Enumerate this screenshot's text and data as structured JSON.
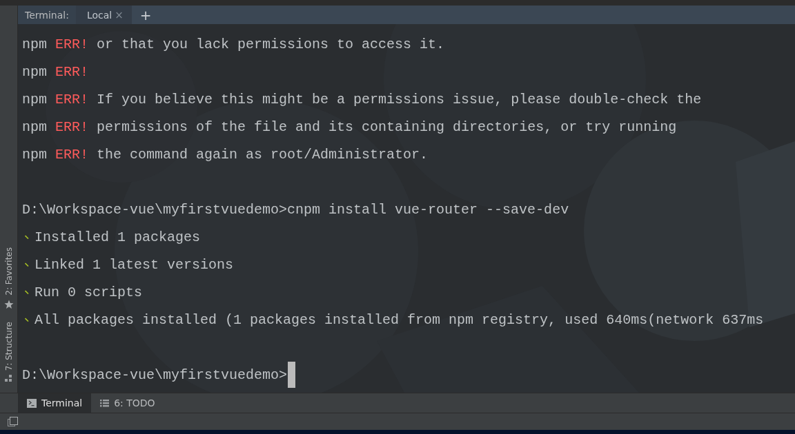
{
  "tool_window": {
    "title": "Terminal:",
    "tabs": [
      {
        "label": "Local",
        "selected": true,
        "close": "×"
      }
    ],
    "add": "+"
  },
  "side_strip": [
    {
      "label": "2: Favorites",
      "kind": "star"
    },
    {
      "label": "7: Structure",
      "kind": "structure"
    }
  ],
  "terminal": {
    "lines": [
      {
        "kind": "err",
        "prefix": "npm",
        "tag": "ERR!",
        "text": "or that you lack permissions to access it."
      },
      {
        "kind": "err",
        "prefix": "npm",
        "tag": "ERR!"
      },
      {
        "kind": "err",
        "prefix": "npm",
        "tag": "ERR!",
        "text": "If you believe this might be a permissions issue, please double-check the"
      },
      {
        "kind": "err",
        "prefix": "npm",
        "tag": "ERR!",
        "text": "permissions of the file and its containing directories, or try running"
      },
      {
        "kind": "err",
        "prefix": "npm",
        "tag": "ERR!",
        "text": "the command again as root/Administrator."
      },
      {
        "kind": "blank"
      },
      {
        "kind": "prompt",
        "text": "D:\\Workspace-vue\\myfirstvuedemo>cnpm install vue-router --save-dev",
        "cursor": false
      },
      {
        "kind": "ok",
        "text": "Installed 1 packages"
      },
      {
        "kind": "ok",
        "text": "Linked 1 latest versions"
      },
      {
        "kind": "ok",
        "text": "Run 0 scripts"
      },
      {
        "kind": "ok",
        "text": "All packages installed (1 packages installed from npm registry, used 640ms(network 637ms"
      },
      {
        "kind": "blank"
      },
      {
        "kind": "prompt",
        "text": "D:\\Workspace-vue\\myfirstvuedemo>",
        "cursor": true
      }
    ]
  },
  "bottom_tabs": [
    {
      "label": "Terminal",
      "kind": "terminal",
      "selected": true
    },
    {
      "label": "6: TODO",
      "kind": "list",
      "selected": false
    }
  ]
}
